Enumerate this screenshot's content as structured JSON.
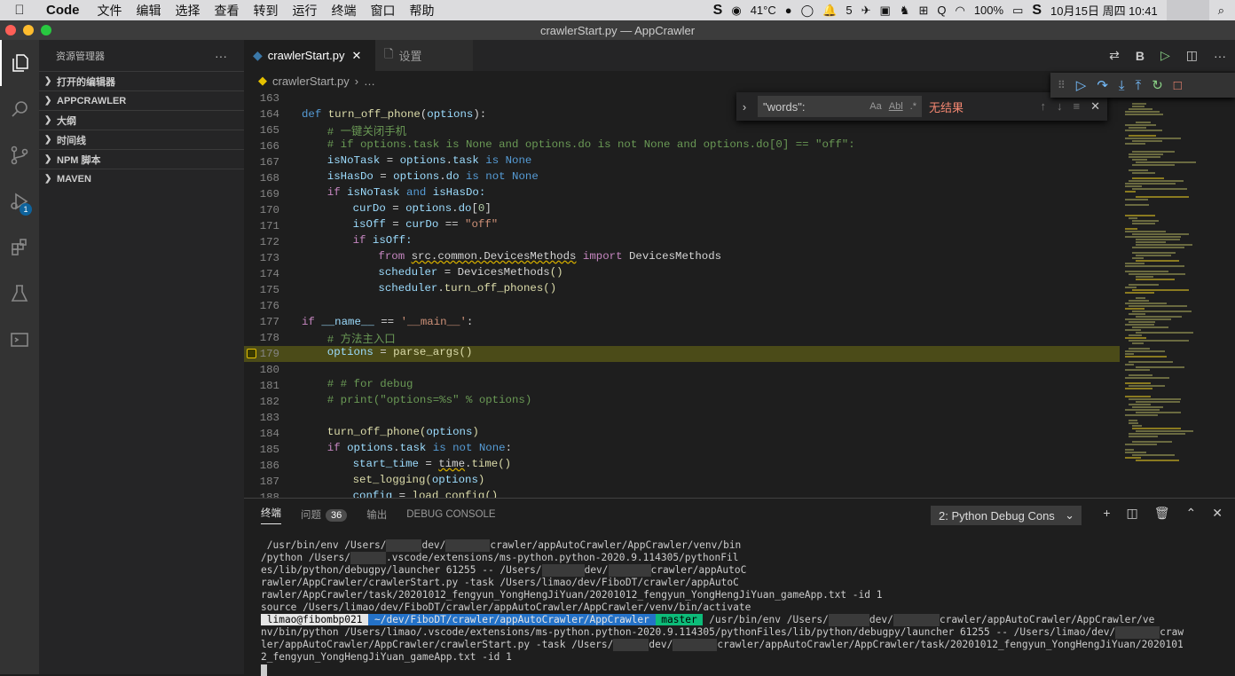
{
  "menubar": {
    "app": "Code",
    "items": [
      "文件",
      "编辑",
      "选择",
      "查看",
      "转到",
      "运行",
      "终端",
      "窗口",
      "帮助"
    ],
    "temperature": "41°C",
    "notifications": "5",
    "battery": "100%",
    "datetime": "10月15日 周四 10:41"
  },
  "window": {
    "title": "crawlerStart.py — AppCrawler"
  },
  "activity": {
    "debug_badge": "1"
  },
  "sidebar": {
    "title": "资源管理器",
    "more": "···",
    "sections": [
      "打开的编辑器",
      "APPCRAWLER",
      "大纲",
      "时间线",
      "NPM 脚本",
      "MAVEN"
    ]
  },
  "tabs": [
    {
      "label": "crawlerStart.py"
    },
    {
      "label": "设置"
    }
  ],
  "breadcrumb": {
    "file": "crawlerStart.py",
    "rest": "…"
  },
  "find": {
    "query": "\"words\":",
    "result": "无结果",
    "case": "Aa",
    "word": "Abl",
    "regex": ".*"
  },
  "editor": {
    "line_numbers": [
      "163",
      "164",
      "165",
      "166",
      "167",
      "168",
      "169",
      "170",
      "171",
      "172",
      "173",
      "174",
      "175",
      "176",
      "177",
      "178",
      "179",
      "180",
      "181",
      "182",
      "183",
      "184",
      "185",
      "186",
      "187",
      "188"
    ],
    "code": {
      "l164": [
        "def",
        "turn_off_phone",
        "(",
        "options",
        "):"
      ],
      "l165": "# 一键关闭手机",
      "l166": "# if options.task is None and options.do is not None and options.do[0] == \"off\":",
      "l167": [
        "isNoTask",
        " = ",
        "options",
        ".",
        "task",
        " is ",
        "None"
      ],
      "l168": [
        "isHasDo",
        " = ",
        "options",
        ".",
        "do",
        " is not ",
        "None"
      ],
      "l169": [
        "if",
        " isNoTask ",
        "and",
        " isHasDo:"
      ],
      "l170": [
        "curDo",
        " = ",
        "options",
        ".",
        "do",
        "[",
        "0",
        "]"
      ],
      "l171": [
        "isOff",
        " = ",
        "curDo",
        " == ",
        "\"off\""
      ],
      "l172": [
        "if",
        " isOff:"
      ],
      "l173": [
        "from",
        " ",
        "src.common.DevicesMethods",
        " ",
        "import",
        " DevicesMethods"
      ],
      "l174": [
        "scheduler",
        " = ",
        "DevicesMethods",
        "()"
      ],
      "l175": [
        "scheduler",
        ".",
        "turn_off_phones",
        "()"
      ],
      "l177": [
        "if",
        " ",
        "__name__",
        " == ",
        "'__main__'",
        ":"
      ],
      "l178": "# 方法主入口",
      "l179": [
        "options",
        " = ",
        "parse_args",
        "()"
      ],
      "l181": "# # for debug",
      "l182": "# print(\"options=%s\" % options)",
      "l184": [
        "turn_off_phone",
        "(",
        "options",
        ")"
      ],
      "l185": [
        "if",
        " options",
        ".",
        "task",
        " is not ",
        "None",
        ":"
      ],
      "l186": [
        "start_time",
        " = ",
        "time",
        ".",
        "time",
        "()"
      ],
      "l187": [
        "set_logging",
        "(",
        "options",
        ")"
      ],
      "l188": [
        "config",
        " = ",
        "load_config",
        "()"
      ]
    }
  },
  "panel": {
    "tabs": {
      "terminal": "终端",
      "problems": "问题",
      "problems_count": "36",
      "output": "输出",
      "debug_console": "DEBUG CONSOLE"
    },
    "terminal_select": "2: Python Debug Cons",
    "terminal": {
      "l1": [
        " /usr/bin/env /Users/",
        "dev/",
        "crawler/appAutoCrawler/AppCrawler/venv/bin"
      ],
      "l2": [
        "/python /Users/",
        ".vscode/extensions/ms-python.python-2020.9.114305/pythonFil"
      ],
      "l3": [
        "es/lib/python/debugpy/launcher 61255 -- /Users/",
        "dev/",
        "crawler/appAutoC"
      ],
      "l4": "rawler/AppCrawler/crawlerStart.py -task /Users/limao/dev/FiboDT/crawler/appAutoC",
      "l5": "rawler/AppCrawler/task/20201012_fengyun_YongHengJiYuan/20201012_fengyun_YongHengJiYuan_gameApp.txt -id 1",
      "l6": "source /Users/limao/dev/FiboDT/crawler/appAutoCrawler/AppCrawler/venv/bin/activate",
      "prompt_user": " limao@fibombp021 ",
      "prompt_path": " ~/dev/FiboDT/crawler/appAutoCrawler/AppCrawler ",
      "prompt_git": " master ",
      "l7": [
        " /usr/bin/env /Users/",
        "dev/",
        "crawler/appAutoCrawler/AppCrawler/ve"
      ],
      "l8": [
        "nv/bin/python /Users/limao/.vscode/extensions/ms-python.python-2020.9.114305/pythonFiles/lib/python/debugpy/launcher 61255 -- /Users/limao/dev/",
        "craw"
      ],
      "l9": [
        "ler/appAutoCrawler/AppCrawler/crawlerStart.py -task /Users/",
        "dev/",
        "crawler/appAutoCrawler/AppCrawler/task/20201012_fengyun_YongHengJiYuan/2020101"
      ],
      "l10": "2_fengyun_YongHengJiYuan_gameApp.txt -id 1"
    }
  }
}
